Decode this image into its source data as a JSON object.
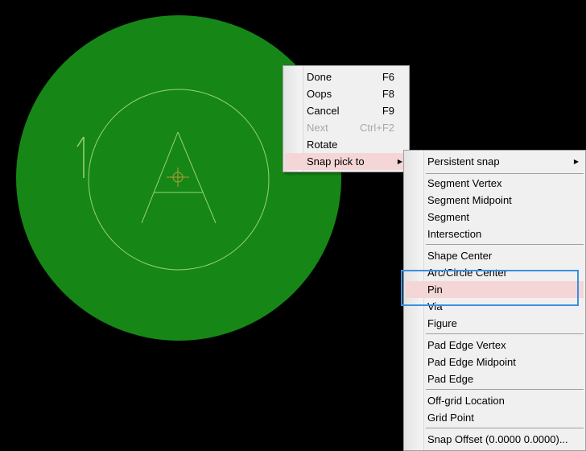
{
  "canvas": {
    "pad_color": "#168716",
    "outline_color": "#9ad27a",
    "pin_marker_color": "#b79b3a",
    "pin_label": "1",
    "pad_letter": "A"
  },
  "context_menu": {
    "items": [
      {
        "label": "Done",
        "accel": "F6",
        "state": "normal"
      },
      {
        "label": "Oops",
        "accel": "F8",
        "state": "normal"
      },
      {
        "label": "Cancel",
        "accel": "F9",
        "state": "normal"
      },
      {
        "label": "Next",
        "accel": "Ctrl+F2",
        "state": "disabled"
      },
      {
        "label": "Rotate",
        "accel": "",
        "state": "normal"
      },
      {
        "label": "Snap pick to",
        "accel": "",
        "state": "highlighted",
        "has_submenu": true
      }
    ]
  },
  "snap_submenu": {
    "persistent_snap": "Persistent snap",
    "group1": [
      "Segment Vertex",
      "Segment Midpoint",
      "Segment",
      "Intersection"
    ],
    "group2": [
      "Shape Center",
      "Arc/Circle Center",
      "Pin",
      "Via",
      "Figure"
    ],
    "group3": [
      "Pad Edge Vertex",
      "Pad Edge Midpoint",
      "Pad Edge"
    ],
    "group4": [
      "Off-grid Location",
      "Grid Point"
    ],
    "group5": [
      "Snap Offset (0.0000 0.0000)..."
    ],
    "highlighted_item": "Pin"
  },
  "colors": {
    "menu_bg": "#f0f0f0",
    "highlight_bg": "#f5d6d6",
    "focus_box": "#3c8fe0"
  }
}
